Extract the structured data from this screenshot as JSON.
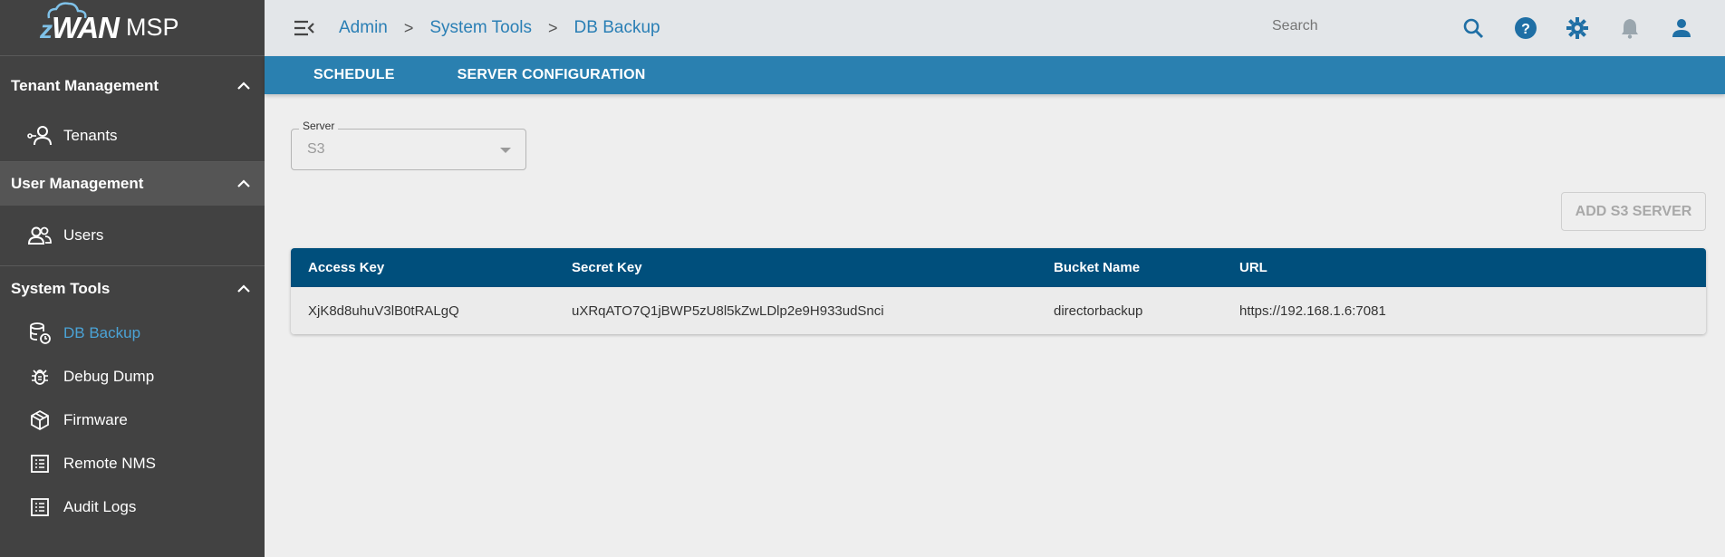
{
  "brand": {
    "logo_text": "WAN",
    "logo_z": "z",
    "product": "MSP"
  },
  "sidebar": {
    "sections": [
      {
        "title": "Tenant Management",
        "items": [
          {
            "label": "Tenants"
          }
        ]
      },
      {
        "title": "User Management",
        "items": [
          {
            "label": "Users"
          }
        ]
      },
      {
        "title": "System Tools",
        "items": [
          {
            "label": "DB Backup"
          },
          {
            "label": "Debug Dump"
          },
          {
            "label": "Firmware"
          },
          {
            "label": "Remote NMS"
          },
          {
            "label": "Audit Logs"
          }
        ]
      }
    ]
  },
  "breadcrumb": {
    "items": [
      "Admin",
      "System Tools",
      "DB Backup"
    ],
    "separator": ">"
  },
  "search": {
    "placeholder": "Search"
  },
  "tabs": [
    "SCHEDULE",
    "SERVER CONFIGURATION"
  ],
  "server": {
    "label": "Server",
    "value": "S3"
  },
  "add_button": "ADD S3 SERVER",
  "table": {
    "headers": [
      "Access Key",
      "Secret Key",
      "Bucket Name",
      "URL"
    ],
    "rows": [
      [
        "XjK8d8uhuV3lB0tRALgQ",
        "uXRqATO7Q1jBWP5zU8l5kZwLDlp2e9H933udSnci",
        "directorbackup",
        "https://192.168.1.6:7081"
      ]
    ]
  },
  "colors": {
    "accent": "#2a80b0",
    "header": "#004f7c",
    "sidebar": "#424242",
    "selected": "#4ba3d6"
  }
}
